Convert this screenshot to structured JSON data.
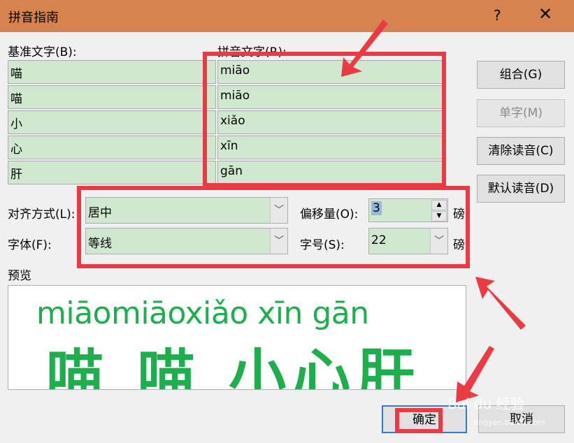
{
  "window": {
    "title": "拼音指南",
    "help": "?",
    "close": "✕"
  },
  "labels": {
    "base_text": "基准文字(B):",
    "ruby_text": "拼音文字(R):"
  },
  "rows": [
    {
      "base": "喵",
      "ruby": "miāo"
    },
    {
      "base": "喵",
      "ruby": "miāo"
    },
    {
      "base": "小",
      "ruby": "xiǎo"
    },
    {
      "base": "心",
      "ruby": "xīn"
    },
    {
      "base": "肝",
      "ruby": "gān"
    }
  ],
  "buttons": {
    "group": "组合(G)",
    "mono": "单字(M)",
    "clear": "清除读音(C)",
    "default": "默认读音(D)",
    "ok": "确定",
    "cancel": "取消"
  },
  "options": {
    "alignment_label": "对齐方式(L):",
    "alignment_value": "居中",
    "offset_label": "偏移量(O):",
    "offset_value": "3",
    "offset_unit": "磅",
    "font_label": "字体(F):",
    "font_value": "等线",
    "size_label": "字号(S):",
    "size_value": "22",
    "size_unit": "磅"
  },
  "preview": {
    "label": "预览",
    "pinyin": "miāomiāoxiǎo xīn gān",
    "hanzi": "喵 喵 小心肝"
  },
  "watermark": {
    "brand": "Bai du 经验",
    "site": "jingyan.baidu.com"
  },
  "colors": {
    "titlebar": "#d7834f",
    "cell_bg": "#cfe8cf",
    "annotation": "#ea3a44",
    "preview_text": "#1fae4e"
  },
  "icons": {
    "dropdown": "chevron-down-icon",
    "spin_up": "triangle-up-icon",
    "spin_down": "triangle-down-icon"
  }
}
